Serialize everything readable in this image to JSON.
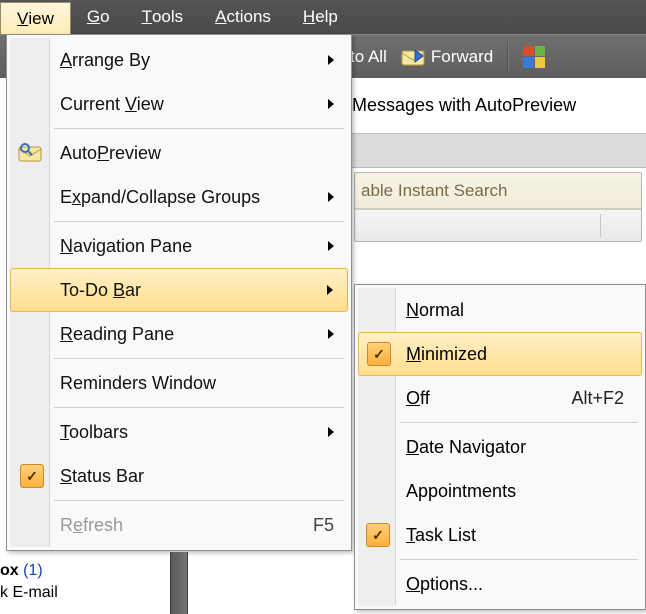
{
  "menubar": {
    "items": [
      {
        "label": "View",
        "mn_index": 0
      },
      {
        "label": "Go",
        "mn_index": 0
      },
      {
        "label": "Tools",
        "mn_index": 0
      },
      {
        "label": "Actions",
        "mn_index": 0
      },
      {
        "label": "Help",
        "mn_index": 0
      }
    ],
    "active": 0
  },
  "toolbar": {
    "reply_all": "to All",
    "forward": "Forward"
  },
  "context_line": "Messages with AutoPreview",
  "search_placeholder": "able Instant Search",
  "view_menu": {
    "items": [
      {
        "label": "Arrange By",
        "mn_index": 0,
        "arrow": true
      },
      {
        "label": "Current View",
        "mn_index": 8,
        "arrow": true
      },
      {
        "label": "AutoPreview",
        "mn_index": 4,
        "icon": "autopreview"
      },
      {
        "label": "Expand/Collapse Groups",
        "mn_index": 1,
        "arrow": true
      },
      {
        "label": "Navigation Pane",
        "mn_index": 0,
        "arrow": true
      },
      {
        "label": "To-Do Bar",
        "mn_index": 6,
        "arrow": true,
        "highlight": true
      },
      {
        "label": "Reading Pane",
        "mn_index": 0,
        "arrow": true
      },
      {
        "label": "Reminders Window",
        "mn_index": -1
      },
      {
        "label": "Toolbars",
        "mn_index": 0,
        "arrow": true
      },
      {
        "label": "Status Bar",
        "mn_index": 0,
        "checked": true
      },
      {
        "label": "Refresh",
        "mn_index": 1,
        "shortcut": "F5",
        "disabled": true
      }
    ],
    "separators_after": [
      1,
      3,
      6,
      7,
      9
    ]
  },
  "todo_submenu": {
    "items": [
      {
        "label": "Normal",
        "mn_index": 0
      },
      {
        "label": "Minimized",
        "mn_index": 0,
        "checked": true,
        "highlight": true
      },
      {
        "label": "Off",
        "mn_index": 0,
        "shortcut": "Alt+F2"
      },
      {
        "label": "Date Navigator",
        "mn_index": 0
      },
      {
        "label": "Appointments",
        "mn_index": -1
      },
      {
        "label": "Task List",
        "mn_index": 0,
        "checked": true
      },
      {
        "label": "Options...",
        "mn_index": 0
      }
    ],
    "separators_after": [
      2,
      5
    ]
  },
  "stray": {
    "line1": "ox (1)",
    "line2": "k E-mail"
  }
}
